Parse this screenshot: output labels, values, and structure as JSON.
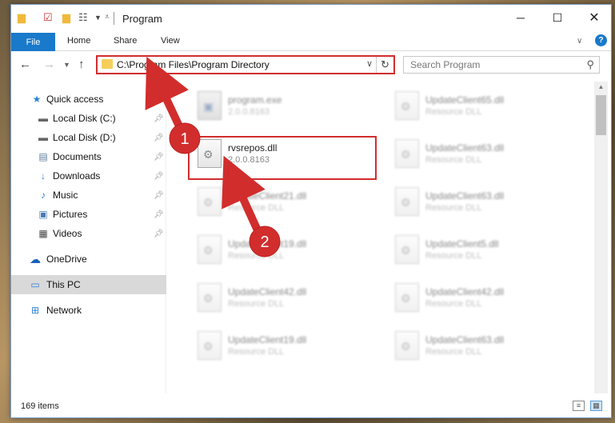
{
  "window": {
    "title": "Program",
    "qa_icons": [
      "folder-icon",
      "properties-icon",
      "new-folder-icon",
      "view-icon"
    ]
  },
  "ribbon": {
    "tabs": [
      "File",
      "Home",
      "Share",
      "View"
    ]
  },
  "address": {
    "path": "C:\\Program Files\\Program Directory"
  },
  "search": {
    "placeholder": "Search Program"
  },
  "sidebar": {
    "items": [
      {
        "label": "Quick access",
        "icon": "star-icon",
        "pinned": false
      },
      {
        "label": "Local Disk (C:)",
        "icon": "drive-icon",
        "pinned": true
      },
      {
        "label": "Local Disk (D:)",
        "icon": "drive-icon",
        "pinned": true
      },
      {
        "label": "Documents",
        "icon": "documents-icon",
        "pinned": true
      },
      {
        "label": "Downloads",
        "icon": "download-icon",
        "pinned": true
      },
      {
        "label": "Music",
        "icon": "music-icon",
        "pinned": true
      },
      {
        "label": "Pictures",
        "icon": "pictures-icon",
        "pinned": true
      },
      {
        "label": "Videos",
        "icon": "videos-icon",
        "pinned": true
      },
      {
        "label": "OneDrive",
        "icon": "cloud-icon",
        "pinned": false
      },
      {
        "label": "This PC",
        "icon": "computer-icon",
        "pinned": false,
        "selected": true
      },
      {
        "label": "Network",
        "icon": "network-icon",
        "pinned": false
      }
    ]
  },
  "files": {
    "col1": [
      {
        "name": "program.exe",
        "sub": "2.0.0.8163"
      },
      {
        "name": "rvsrepos.dll",
        "sub": "2.0.0.8163"
      },
      {
        "name": "UpdateClient21.dll",
        "sub": "Resource DLL"
      },
      {
        "name": "UpdateClient19.dll",
        "sub": "Resource DLL"
      },
      {
        "name": "UpdateClient42.dll",
        "sub": "Resource DLL"
      },
      {
        "name": "UpdateClient19.dll",
        "sub": "Resource DLL"
      }
    ],
    "col2": [
      {
        "name": "UpdateClient65.dll",
        "sub": "Resource DLL"
      },
      {
        "name": "UpdateClient63.dll",
        "sub": "Resource DLL"
      },
      {
        "name": "UpdateClient63.dll",
        "sub": "Resource DLL"
      },
      {
        "name": "UpdateClient5.dll",
        "sub": "Resource DLL"
      },
      {
        "name": "UpdateClient42.dll",
        "sub": "Resource DLL"
      },
      {
        "name": "UpdateClient63.dll",
        "sub": "Resource DLL"
      }
    ]
  },
  "status": {
    "count": "169 items"
  },
  "annotations": {
    "step1": "1",
    "step2": "2",
    "color": "#d22d2d"
  }
}
